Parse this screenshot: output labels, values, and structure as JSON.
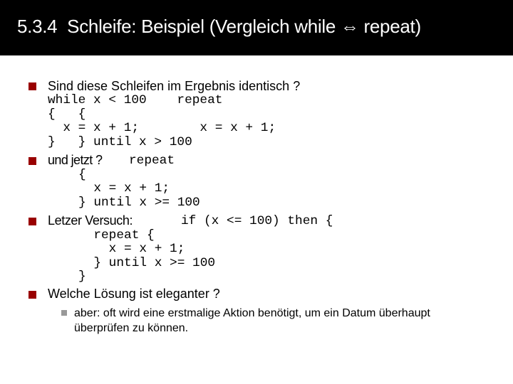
{
  "slide": {
    "title": "5.3.4  Schleife: Beispiel (Vergleich while ⇔ repeat)",
    "accent_color": "#990000",
    "sub_bullet_color": "#999999"
  },
  "items": [
    {
      "text": "Sind diese Schleifen im Ergebnis identisch ?",
      "code": [
        "while x < 100    repeat",
        "{   {",
        "  x = x + 1;        x = x + 1;",
        "}   } until x > 100"
      ]
    },
    {
      "text": "und jetzt ?",
      "code_inline": "repeat",
      "code": [
        "{",
        "  x = x + 1;",
        "} until x >= 100"
      ]
    },
    {
      "text": "Letzer Versuch:",
      "code_inline": "if (x <= 100) then {",
      "code": [
        "  repeat {",
        "    x = x + 1;",
        "  } until x >= 100",
        "}"
      ]
    },
    {
      "text": "Welche Lösung ist eleganter ?",
      "sub_items": [
        {
          "text": "aber: oft wird eine erstmalige Aktion benötigt, um ein Datum überhaupt\nüberprüfen zu können."
        }
      ]
    }
  ]
}
